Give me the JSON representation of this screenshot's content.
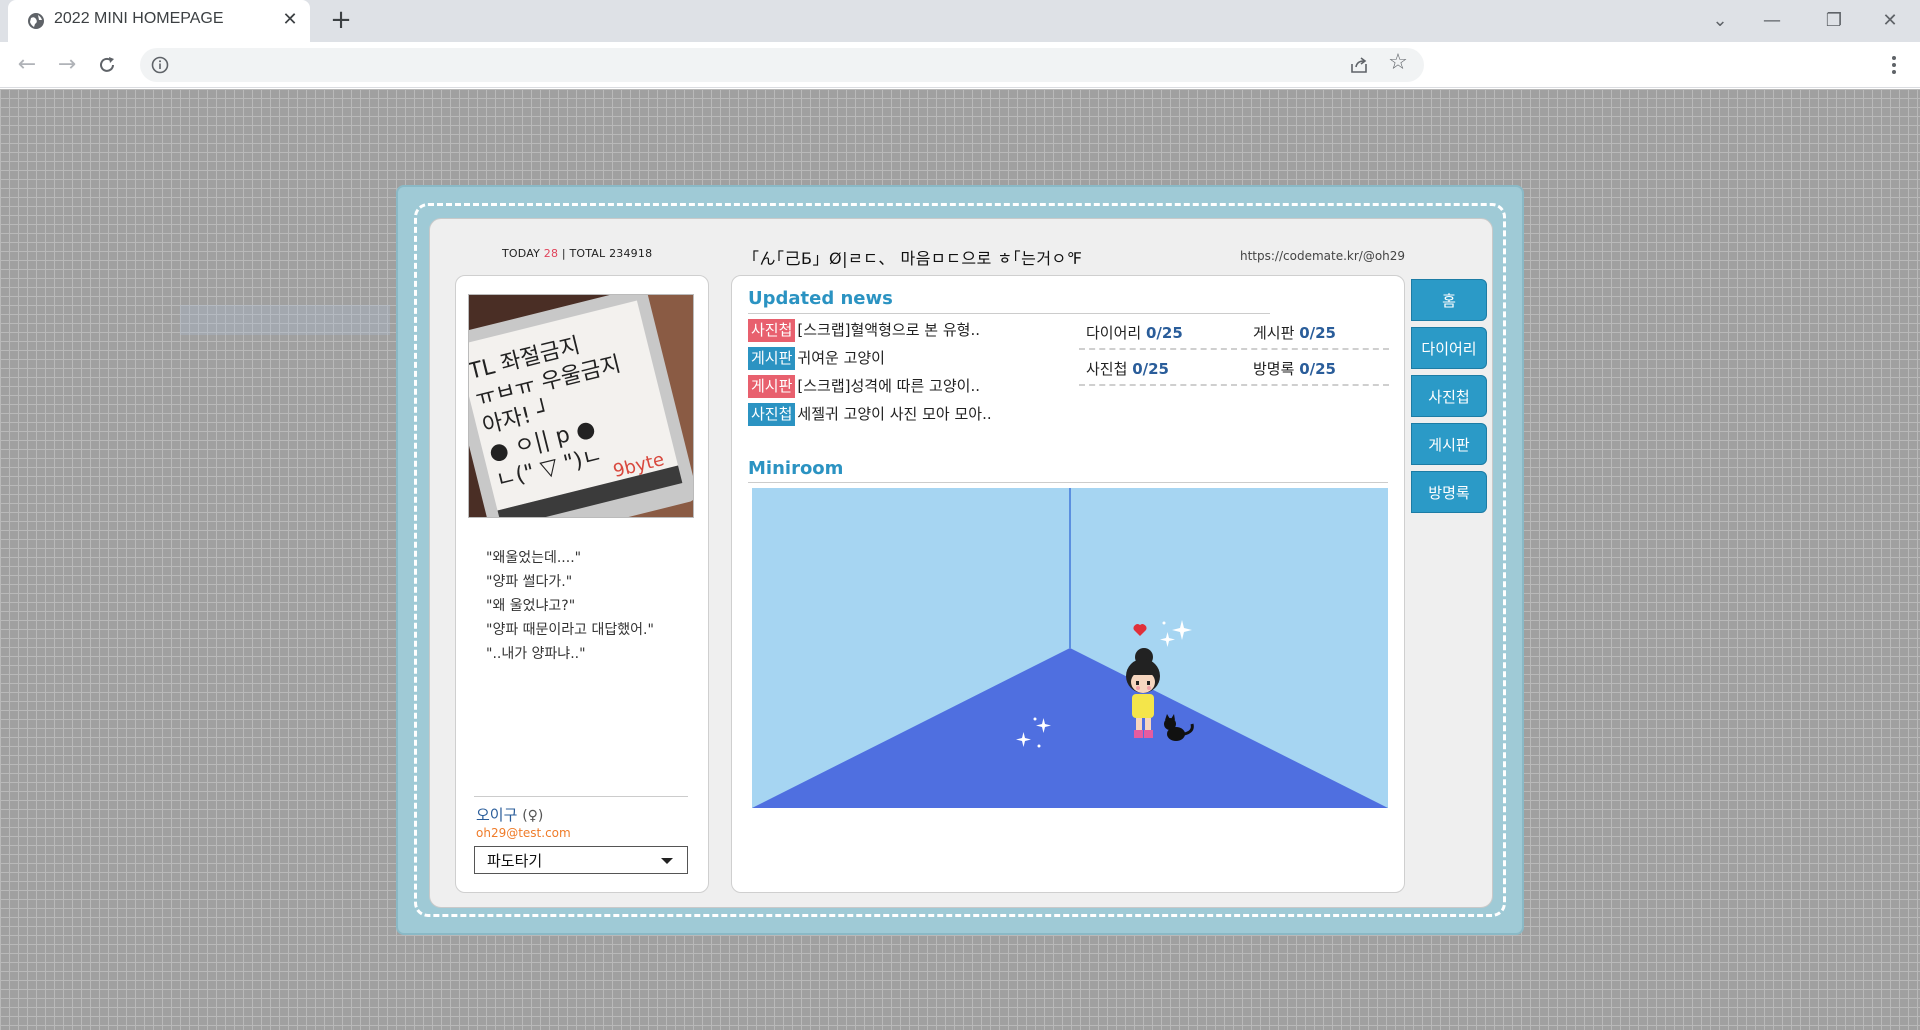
{
  "browser": {
    "tab_title": "2022 MINI HOMEPAGE",
    "tab_close": "✕",
    "new_tab": "+",
    "window_controls": [
      "⌄",
      "—",
      "❐",
      "✕"
    ]
  },
  "page": {
    "counter": {
      "today_label": "TODAY",
      "today_value": "28",
      "separator": "|",
      "total_label": "TOTAL",
      "total_value": "234918"
    },
    "site_title": "「ん｢己Ƃ」Ø|ㄹㄷ、 마음ㅁㄷ으로 ㅎ｢는거ㅇ℉",
    "site_url": "https://codemate.kr/@oh29",
    "profile": {
      "photo_alt": "9byte",
      "photo_lines": [
        "TL 좌절금지",
        "ㅠㅂㅠ 우울금지",
        "아자! ┘",
        "● ㅇ|| p ●",
        "ㄴ(\" ▽ \")ㄴ",
        "9byte"
      ],
      "quote_lines": [
        "\"왜울었는데....\"",
        "\"양파 썰다가.\"",
        "\"왜 울었냐고?\"",
        "\"양파 때문이라고 대답했어.\"",
        "\"..내가 양파냐..\""
      ],
      "name": "오이구",
      "gender": "(♀)",
      "email": "oh29@test.com",
      "select_value": "파도타기"
    },
    "updated_news": {
      "title": "Updated news",
      "items": [
        {
          "badge": "사진첩",
          "color": "red",
          "text": "[스크랩]혈액형으로 본 유형.."
        },
        {
          "badge": "게시판",
          "color": "blue",
          "text": "귀여운 고양이"
        },
        {
          "badge": "게시판",
          "color": "red",
          "text": "[스크랩]성격에 따른 고양이.."
        },
        {
          "badge": "사진첩",
          "color": "blue",
          "text": "세젤귀 고양이 사진 모아 모아.."
        }
      ],
      "stats": [
        {
          "label": "다이어리",
          "value": "0/25"
        },
        {
          "label": "게시판",
          "value": "0/25"
        },
        {
          "label": "사진첩",
          "value": "0/25"
        },
        {
          "label": "방명록",
          "value": "0/25"
        }
      ]
    },
    "miniroom": {
      "title": "Miniroom",
      "wall_color": "#a6d5f2",
      "floor_color": "#4f6fe0"
    },
    "nav_tabs": [
      "홈",
      "다이어리",
      "사진첩",
      "게시판",
      "방명록"
    ],
    "colors": {
      "frame": "#9fcad6",
      "accent": "#2b93c2",
      "badge_red": "#e8606e",
      "today_red": "#e0435a",
      "email_orange": "#ef7c2a"
    }
  }
}
